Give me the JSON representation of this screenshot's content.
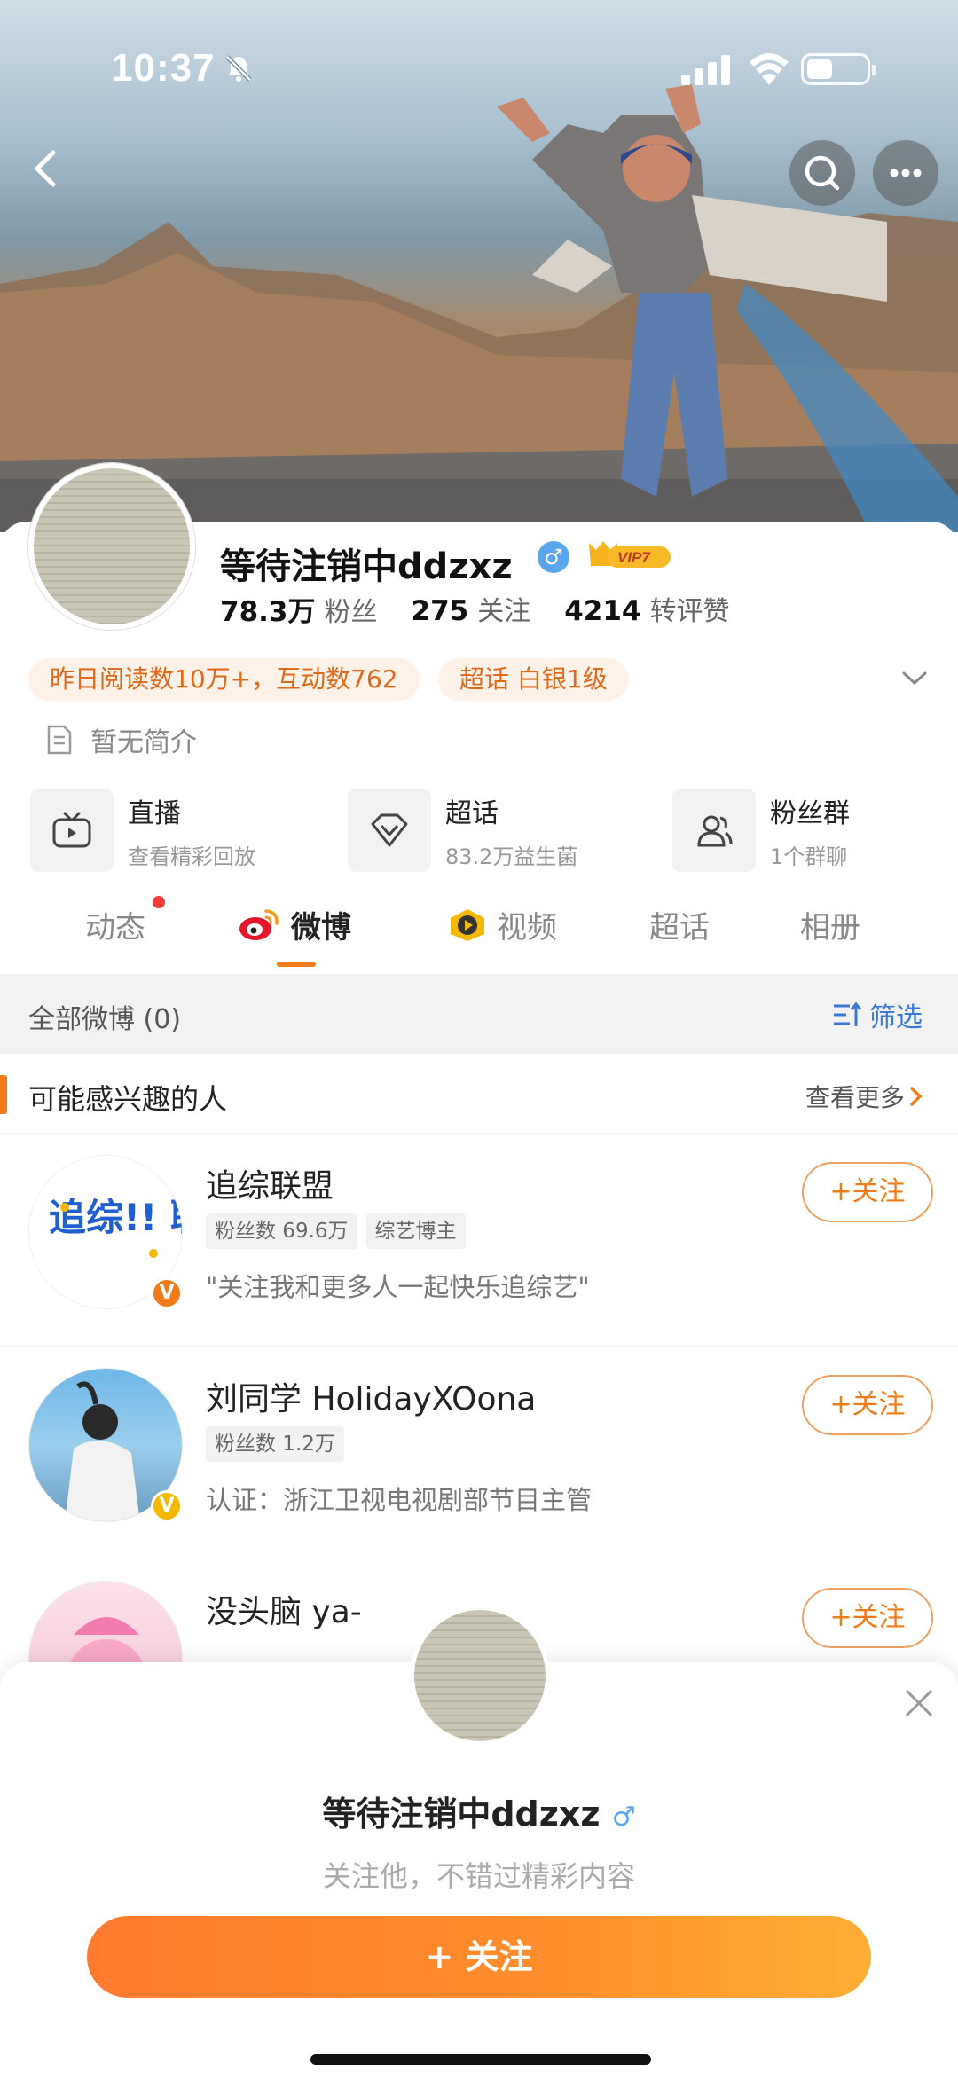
{
  "status_bar": {
    "time": "10:37"
  },
  "profile": {
    "name": "等待注销中ddzxz",
    "gender_symbol": "♂",
    "vip_label": "VIP7",
    "stats": [
      {
        "num": "78.3万",
        "label": "粉丝"
      },
      {
        "num": "275",
        "label": "关注"
      },
      {
        "num": "4214",
        "label": "转评赞"
      }
    ],
    "chips": [
      "昨日阅读数10万+，互动数762",
      "超话 白银1级"
    ],
    "bio": "暂无简介"
  },
  "features": [
    {
      "title": "直播",
      "sub": "查看精彩回放",
      "icon": "tv-icon"
    },
    {
      "title": "超话",
      "sub": "83.2万益生菌",
      "icon": "diamond-icon"
    },
    {
      "title": "粉丝群",
      "sub": "1个群聊",
      "icon": "group-icon"
    }
  ],
  "tabs": [
    "动态",
    "微博",
    "视频",
    "超话",
    "相册"
  ],
  "filter": {
    "label": "全部微博 (0)",
    "action": "筛选"
  },
  "suggest": {
    "title": "可能感兴趣的人",
    "more": "查看更多"
  },
  "people": [
    {
      "name": "追综联盟",
      "tags": [
        "粉丝数 69.6万",
        "综艺博主"
      ],
      "desc": "\"关注我和更多人一起快乐追综艺\"",
      "follow": "+关注",
      "badge_color": "#f07b18",
      "avatar_text": "追综!! 联盟"
    },
    {
      "name": "刘同学 HolidayXOona",
      "tags": [
        "粉丝数 1.2万"
      ],
      "desc": "认证：浙江卫视电视剧部节目主管",
      "follow": "+关注",
      "badge_color": "#f5b800"
    },
    {
      "name": "没头脑 ya-",
      "tags": [],
      "desc": "",
      "follow": "+关注"
    }
  ],
  "sheet": {
    "name": "等待注销中ddzxz",
    "gender_symbol": "♂",
    "subtitle": "关注他，不错过精彩内容",
    "button": "+ 关注"
  },
  "colors": {
    "accent": "#f07b18",
    "link": "#3a78d6",
    "male": "#5aa6ec"
  }
}
